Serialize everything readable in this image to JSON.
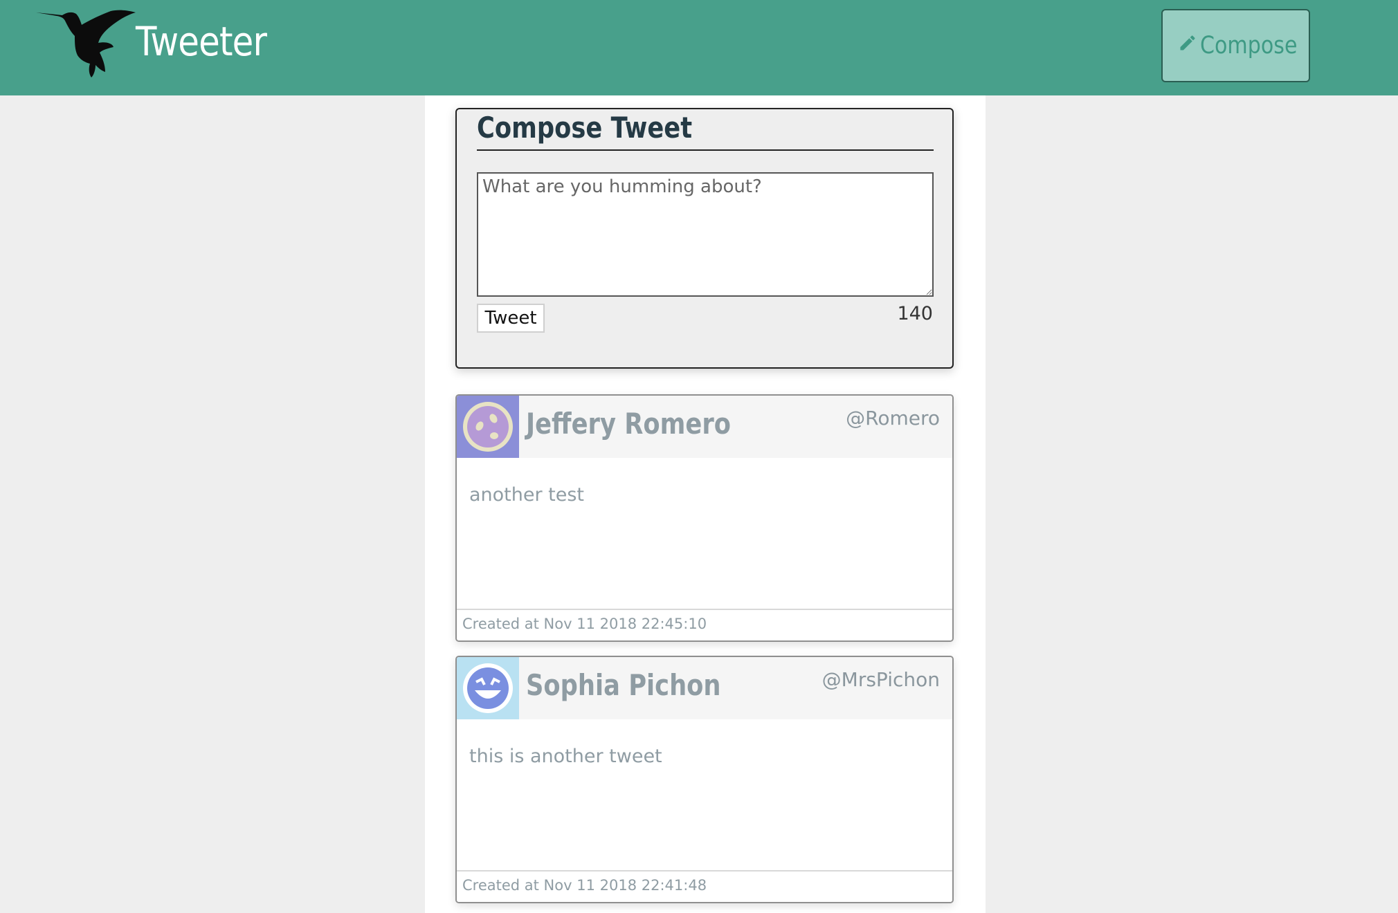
{
  "header": {
    "brand": "Tweeter",
    "logo_icon": "hummingbird-icon",
    "compose_label": "Compose",
    "compose_icon": "pencil-icon",
    "background": "#48a08b"
  },
  "composer": {
    "title": "Compose Tweet",
    "placeholder": "What are you humming about?",
    "value": "",
    "submit_label": "Tweet",
    "char_count": "140"
  },
  "tweets": [
    {
      "name": "Jeffery Romero",
      "handle": "@Romero",
      "content": "another test",
      "created": "Created at Nov 11 2018 22:45:10",
      "avatar_bg": "#8b8fd8",
      "avatar_icon": "smiley-avatar-icon"
    },
    {
      "name": "Sophia Pichon",
      "handle": "@MrsPichon",
      "content": "this is another tweet",
      "created": "Created at Nov 11 2018 22:41:48",
      "avatar_bg": "#b9e1f2",
      "avatar_icon": "grinning-avatar-icon"
    }
  ]
}
